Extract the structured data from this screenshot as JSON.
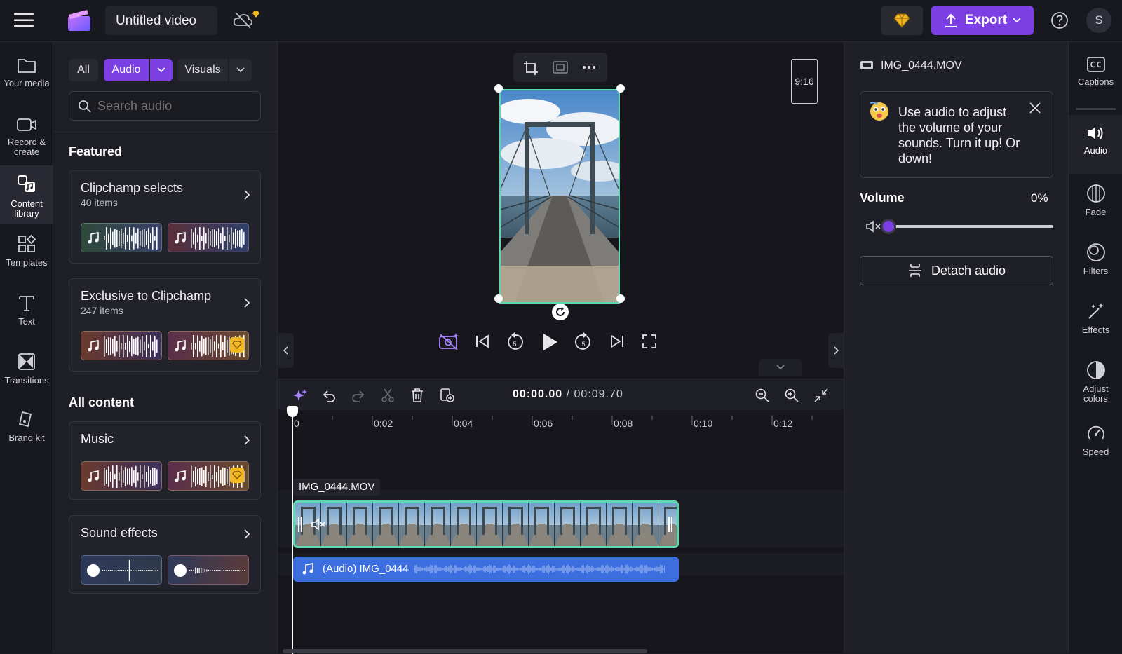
{
  "header": {
    "title": "Untitled video",
    "export_label": "Export",
    "avatar_initial": "S"
  },
  "left_nav": [
    {
      "label": "Your media"
    },
    {
      "label": "Record &\ncreate"
    },
    {
      "label": "Content\nlibrary"
    },
    {
      "label": "Templates"
    },
    {
      "label": "Text"
    },
    {
      "label": "Transitions"
    },
    {
      "label": "Brand kit"
    }
  ],
  "library": {
    "filters": {
      "all": "All",
      "audio": "Audio",
      "visuals": "Visuals"
    },
    "search_placeholder": "Search audio",
    "featured_heading": "Featured",
    "all_content_heading": "All content",
    "cards": [
      {
        "title": "Clipchamp selects",
        "subtitle": "40 items"
      },
      {
        "title": "Exclusive to Clipchamp",
        "subtitle": "247 items"
      },
      {
        "title": "Music",
        "subtitle": ""
      },
      {
        "title": "Sound effects",
        "subtitle": ""
      }
    ]
  },
  "preview": {
    "aspect_ratio": "9:16"
  },
  "timeline": {
    "current_time": "00:00.00",
    "total_time": "/ 00:09.70",
    "ticks": [
      "0",
      "0:02",
      "0:04",
      "0:06",
      "0:08",
      "0:10",
      "0:12"
    ],
    "clip_label": "IMG_0444.MOV",
    "audio_clip_label": "(Audio) IMG_0444"
  },
  "properties": {
    "file_name": "IMG_0444.MOV",
    "tip_text": "Use audio to adjust the volume of your sounds. Turn it up! Or down!",
    "volume_label": "Volume",
    "volume_value": "0%",
    "volume_level": 0,
    "detach_label": "Detach audio"
  },
  "right_nav": [
    {
      "label": "Captions"
    },
    {
      "label": "Audio"
    },
    {
      "label": "Fade"
    },
    {
      "label": "Filters"
    },
    {
      "label": "Effects"
    },
    {
      "label": "Adjust\ncolors"
    },
    {
      "label": "Speed"
    }
  ],
  "colors": {
    "accent": "#7b3fe4",
    "audio_track": "#3d6ee0",
    "clip_border": "#5fd6b0",
    "premium": "#f2b824"
  }
}
